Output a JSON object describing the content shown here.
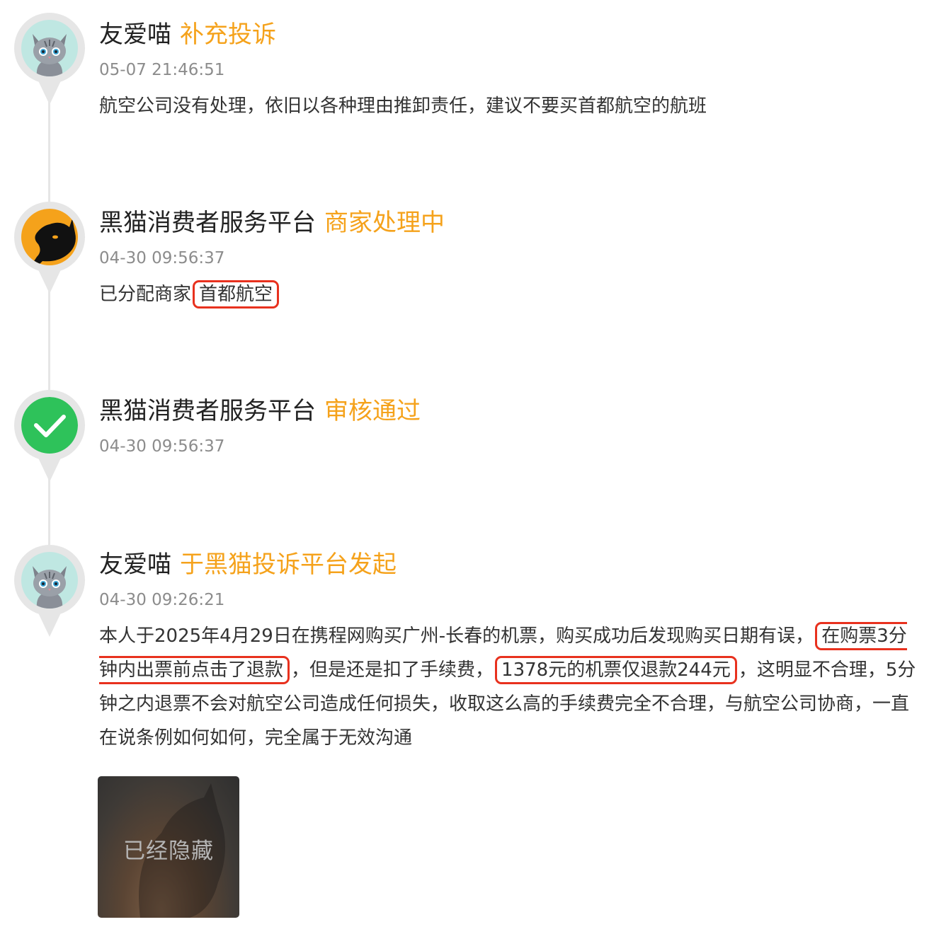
{
  "colors": {
    "accent": "#f5a21b",
    "highlight_border": "#e8311e",
    "check_green": "#2ec25a",
    "timeline": "#e6e6e6"
  },
  "entries": [
    {
      "author": "友爱喵",
      "action": "补充投诉",
      "time": "05-07 21:46:51",
      "content": "航空公司没有处理，依旧以各种理由推卸责任，建议不要买首都航空的航班",
      "avatar_icon": "gray-cat-avatar-icon"
    },
    {
      "author": "黑猫消费者服务平台",
      "action": "商家处理中",
      "time": "04-30 09:56:37",
      "content_prefix": "已分配商家",
      "content_highlight": "首都航空",
      "avatar_icon": "black-cat-logo-icon"
    },
    {
      "author": "黑猫消费者服务平台",
      "action": "审核通过",
      "time": "04-30 09:56:37",
      "avatar_icon": "green-check-icon"
    },
    {
      "author": "友爱喵",
      "action": "于黑猫投诉平台发起",
      "time": "04-30 09:26:21",
      "content_parts": [
        "本人于2025年4月29日在携程网购买广州-长春的机票，购买成功后发现购买日期有误，",
        "在购票3分钟内出票前点击了退款",
        "，但是还是扣了手续费，",
        "1378元的机票仅退款244元",
        "，这明显不合理，5分钟之内退票不会对航空公司造成任何损失，收取这么高的手续费完全不合理，与航空公司协商，一直在说条例如何如何，完全属于无效沟通"
      ],
      "avatar_icon": "gray-cat-avatar-icon",
      "attachment_label": "已经隐藏"
    }
  ]
}
